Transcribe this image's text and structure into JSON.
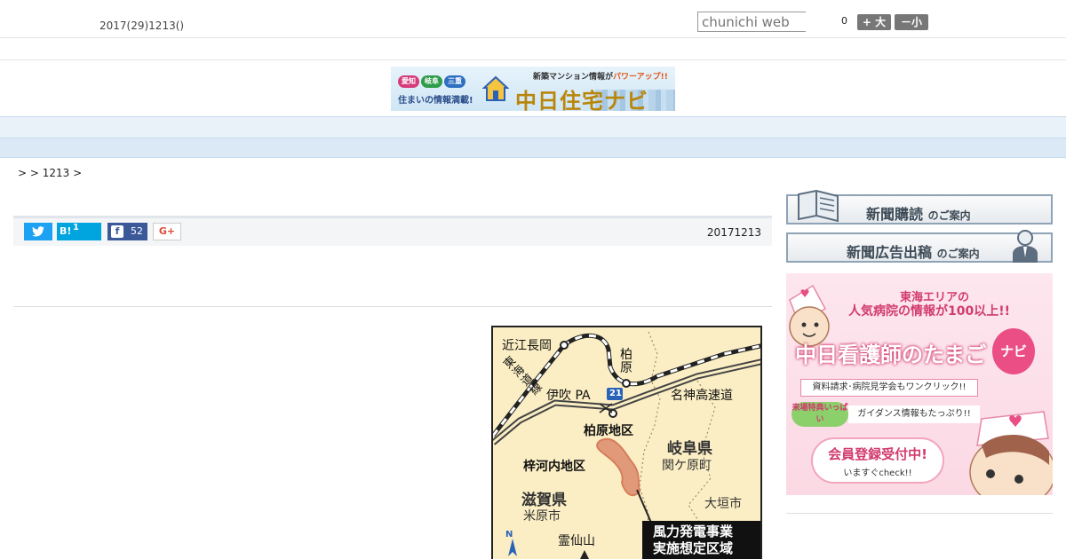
{
  "header": {
    "date": "2017(29)1213()",
    "search_placeholder": "chunichi web",
    "count": "0",
    "font_larger": "+ 大",
    "font_smaller": "－小"
  },
  "banner": {
    "tags": [
      "愛知",
      "岐阜",
      "三重"
    ],
    "subtitle": "住まいの情報満載!",
    "headline_prefix": "新築マンション情報が",
    "headline_accent": "パワーアップ!!",
    "logo": "中日住宅ナビ"
  },
  "nav": {
    "items": [
      "",
      "",
      "",
      "",
      "",
      "",
      "",
      "",
      ""
    ]
  },
  "breadcrumb": {
    "text": ">  > 1213 >"
  },
  "share": {
    "hatena_label": "B!",
    "hatena_count": "1",
    "facebook_count": "52",
    "gplus_label": "G+",
    "date": "20171213"
  },
  "map": {
    "labels": {
      "omi_nagaoka": "近江長岡",
      "kashiwabara": "柏原",
      "tokaido_line": "東海道線",
      "ibuki_pa": "伊吹 PA",
      "route": "21",
      "meishin": "名神高速道",
      "kashiwabara_district": "柏原地区",
      "gifu": "岐阜県",
      "sekigahara": "関ケ原町",
      "azusakawachi": "梓河内地区",
      "shiga": "滋賀県",
      "maibara": "米原市",
      "ogaki": "大垣市",
      "ryozen": "霊仙山",
      "north": "N",
      "legend_line1": "風力発電事業",
      "legend_line2": "実施想定区域"
    }
  },
  "sidebar": {
    "subscribe_main": "新聞購読",
    "subscribe_tail": "のご案内",
    "ads_main": "新聞広告出稿",
    "ads_tail": "のご案内",
    "ad": {
      "headline1": "東海エリアの",
      "headline2": "人気病院の情報が100以上!!",
      "title": "中日看護師のたまご",
      "navi": "ナビ",
      "band1": "資料請求･病院見学会もワンクリック!!",
      "badge": "来場特典いっぱい",
      "band2": "ガイダンス情報もたっぷり!!",
      "cta_main": "会員登録受付中!",
      "cta_sub": "いますぐcheck!!"
    }
  }
}
